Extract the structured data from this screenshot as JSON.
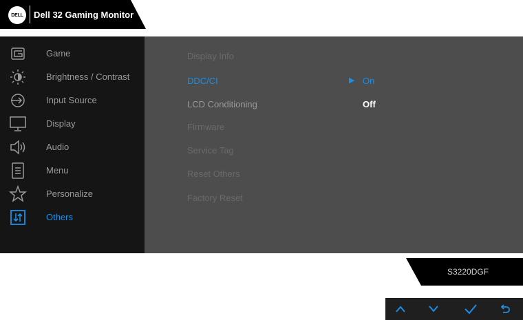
{
  "header": {
    "logo_text": "DELL",
    "title": "Dell 32 Gaming Monitor"
  },
  "sidebar": {
    "items": [
      {
        "label": "Game",
        "icon": "game-icon"
      },
      {
        "label": "Brightness / Contrast",
        "icon": "brightness-icon"
      },
      {
        "label": "Input Source",
        "icon": "input-source-icon"
      },
      {
        "label": "Display",
        "icon": "display-icon"
      },
      {
        "label": "Audio",
        "icon": "audio-icon"
      },
      {
        "label": "Menu",
        "icon": "menu-icon"
      },
      {
        "label": "Personalize",
        "icon": "personalize-icon"
      },
      {
        "label": "Others",
        "icon": "others-icon"
      }
    ],
    "active": "Others"
  },
  "others_menu": {
    "items": [
      {
        "label": "Display Info"
      },
      {
        "label": "DDC/CI"
      },
      {
        "label": "LCD Conditioning"
      },
      {
        "label": "Firmware"
      },
      {
        "label": "Service Tag"
      },
      {
        "label": "Reset Others"
      },
      {
        "label": "Factory Reset"
      }
    ],
    "selected": "DDC/CI",
    "options": {
      "on": "On",
      "off": "Off"
    },
    "selected_option": "On"
  },
  "model": "S3220DGF",
  "nav_buttons": [
    {
      "icon": "up-chevron-icon"
    },
    {
      "icon": "down-chevron-icon"
    },
    {
      "icon": "check-icon"
    },
    {
      "icon": "back-icon"
    }
  ],
  "colors": {
    "accent": "#1b8fe6",
    "sidebar_bg": "#151515",
    "panel_bg": "#4d4d4d"
  }
}
